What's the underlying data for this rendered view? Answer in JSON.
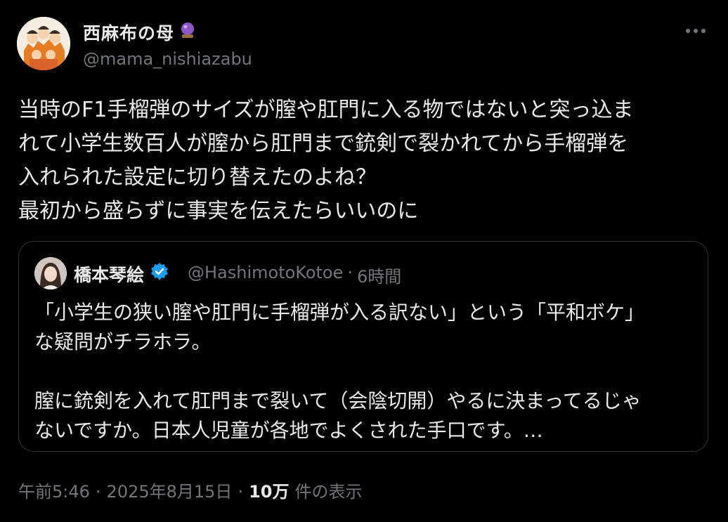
{
  "author": {
    "name": "西麻布の母",
    "handle": "@mama_nishiazabu"
  },
  "tweet_lines": [
    "当時のF1手榴弾のサイズが膣や肛門に入る物ではないと突っ込ま",
    "れて小学生数百人が膣から肛門まで銃剣で裂かれてから手榴弾を",
    "入れられた設定に切り替えたのよね？",
    "最初から盛らずに事実を伝えたらいいのに"
  ],
  "quote": {
    "name": "橋本琴絵",
    "handle": "@HashimotoKotoe",
    "separator": "·",
    "time": "6時間",
    "lines": [
      "「小学生の狭い膣や肛門に手榴弾が入る訳ない」という「平和ボケ」",
      "な疑問がチラホラ。",
      "",
      "膣に銃剣を入れて肛門まで裂いて（会陰切開）やるに決まってるじゃ",
      "ないですか。日本人児童が各地でよくされた手口です。…"
    ]
  },
  "footer": {
    "time": "午前5:46",
    "sep1": "·",
    "date": "2025年8月15日",
    "sep2": "·",
    "views": "10万",
    "views_label": "件の表示"
  },
  "icons": {
    "badge": "crystal-ball-icon",
    "verified": "verified-badge-icon",
    "more": "more-options-icon"
  },
  "colors": {
    "background": "#000000",
    "text": "#e7e9ea",
    "muted": "#71767b",
    "verified": "#1d9bf0",
    "border": "#2f3336"
  }
}
